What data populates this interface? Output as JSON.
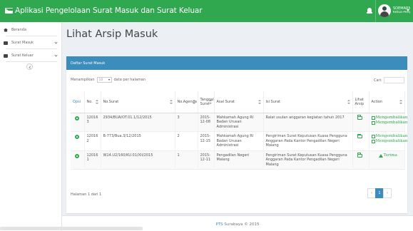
{
  "app": {
    "title": "Aplikasi Pengelolaan Surat Masuk dan Surat Keluar",
    "user_name": "SOEMARNO, S...",
    "user_role": "Ketua Pengadi..."
  },
  "sidebar": {
    "items": [
      {
        "label": "Beranda",
        "icon": "home-icon"
      },
      {
        "label": "Surat Masuk",
        "icon": "envelope-icon"
      },
      {
        "label": "Surat Keluar",
        "icon": "envelope-icon"
      }
    ]
  },
  "main": {
    "page_title": "Lihat Arsip Masuk",
    "box_title": "Daftar Surat Masuk",
    "length_prefix": "Menampilkan",
    "length_value": "10",
    "length_suffix": "data per halaman",
    "search_label": "Cari:",
    "columns": [
      "Opsi",
      "No.",
      "No.Surat",
      "No.Agenda",
      "Tanggal Surat",
      "Asal Surat",
      "Isi Surat",
      "Lihat Arsip",
      "Action"
    ],
    "rows": [
      {
        "no": "120163",
        "no_surat": "2934/BUA/OT.01.1/12/2015",
        "no_agenda": "3",
        "tanggal": "2015-12-08",
        "asal": "Mahkamah Agung RI Badan Urusan Administrasi",
        "isi": "Ralat usulan anggaran kegiatan tahun 2017",
        "action1": "Mengembalikan",
        "action2": "Mengembalikan"
      },
      {
        "no": "120162",
        "no_surat": "B-773/Bua.3/12/2015",
        "no_agenda": "2",
        "tanggal": "2015-12-15",
        "asal": "Mahkamah Agung RI Badan Urusan Administrasi",
        "isi": "Pengiriman Surat Keputusan Kuasa Pengguna Anggaran Pada Kantor Pengadilan Negeri Malang",
        "action1": "Mengembalikan",
        "action2": "Mengembalikan"
      },
      {
        "no": "120161",
        "no_surat": "W14.U2/160/KU.01/XII/2015",
        "no_agenda": "1",
        "tanggal": "2015-12-11",
        "asal": "Pengadilan Negeri Malang",
        "isi": "Pengiriman Surat Keputusan Kuasa Pengguna Anggaran Pada Kantor Pengadilan Negeri Malang",
        "action1": "Terima",
        "action2": ""
      }
    ],
    "info": "Halaman 1 dari 1",
    "pagination": {
      "prev": "«",
      "current": "1",
      "next": "»"
    }
  },
  "footer": {
    "brand": "PTS",
    "text": " Surabaya © 2015"
  },
  "colors": {
    "topbar": "#2fa84f",
    "box_header": "#3c8dbc",
    "action_green": "#2fa84f"
  }
}
